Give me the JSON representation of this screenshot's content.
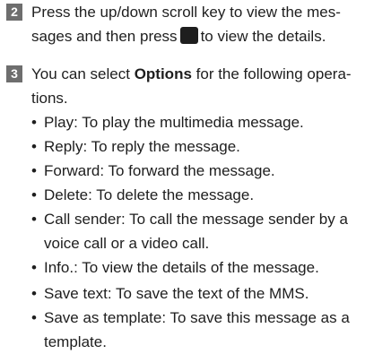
{
  "step2": {
    "number": "2",
    "line1": "Press the up/down scroll key to view the mes-",
    "line2_before": "sages and then press",
    "line2_after": "to view the details.",
    "key_icon": "center-select-key-icon"
  },
  "step3": {
    "number": "3",
    "line1_before": "You can select",
    "options_word": "Options",
    "line1_after": "for the following opera-",
    "line2": "tions.",
    "bullet_char": "•",
    "bullets": [
      {
        "line1": "Play: To play the multimedia message."
      },
      {
        "line1": "Reply: To reply the message."
      },
      {
        "line1": "Forward: To forward the message."
      },
      {
        "line1": "Delete: To delete the message."
      },
      {
        "line1": "Call sender: To call the message sender by a",
        "line2": "voice call or a video call."
      },
      {
        "line1": "Info.: To view the details of the message."
      },
      {
        "line1": "Save text: To save the text of the MMS."
      },
      {
        "line1": "Save as template: To save this message as a",
        "line2": "template."
      }
    ]
  }
}
